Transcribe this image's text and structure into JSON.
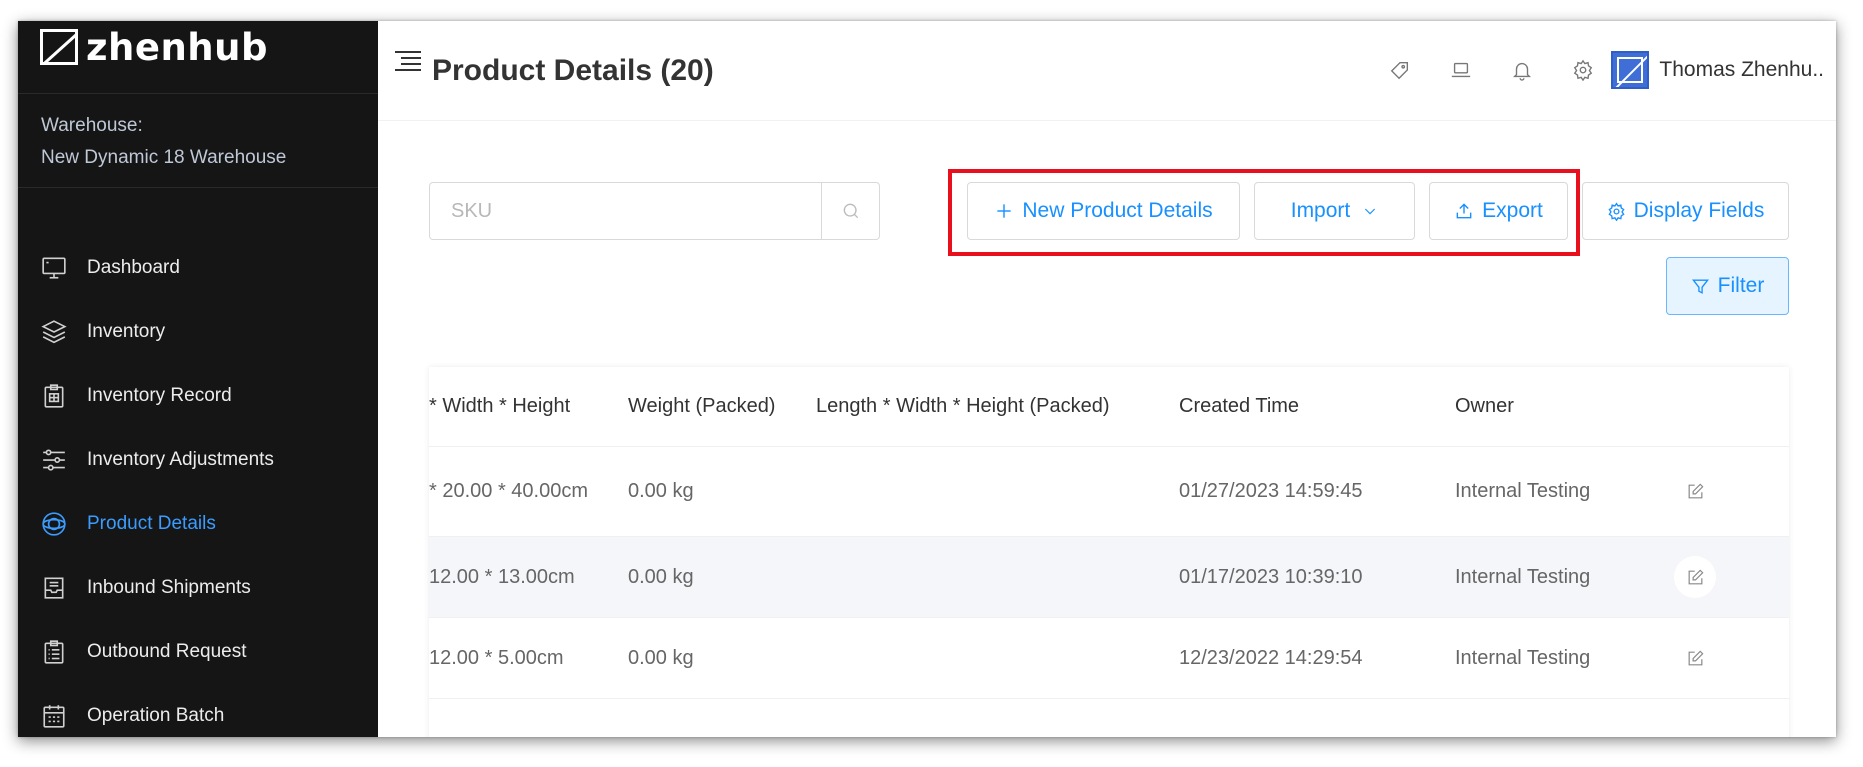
{
  "sidebar": {
    "brand": "zhenhub",
    "warehouse_label": "Warehouse:",
    "warehouse_name": "New Dynamic 18 Warehouse",
    "items": [
      {
        "label": "Dashboard",
        "icon": "monitor-icon"
      },
      {
        "label": "Inventory",
        "icon": "layers-icon"
      },
      {
        "label": "Inventory Record",
        "icon": "clipboard-icon"
      },
      {
        "label": "Inventory Adjustments",
        "icon": "sliders-icon"
      },
      {
        "label": "Product Details",
        "icon": "product-icon",
        "active": true
      },
      {
        "label": "Inbound Shipments",
        "icon": "inbox-icon"
      },
      {
        "label": "Outbound Request",
        "icon": "checklist-icon"
      },
      {
        "label": "Operation Batch",
        "icon": "calendar-icon"
      }
    ]
  },
  "header": {
    "title": "Product Details (20)",
    "user_name": "Thomas Zhenhu..",
    "icons": [
      "tag-icon",
      "laptop-icon",
      "bell-icon",
      "gear-icon"
    ]
  },
  "toolbar": {
    "search_placeholder": "SKU",
    "new_label": "New Product Details",
    "import_label": "Import",
    "export_label": "Export",
    "display_fields_label": "Display Fields",
    "filter_label": "Filter",
    "highlight_color": "#e8101c",
    "accent_color": "#1890ff"
  },
  "table": {
    "headers": [
      "* Width * Height",
      "Weight (Packed)",
      "Length * Width * Height (Packed)",
      "Created Time",
      "Owner"
    ],
    "rows": [
      [
        "* 20.00 * 40.00cm",
        "0.00 kg",
        "",
        "01/27/2023 14:59:45",
        "Internal Testing"
      ],
      [
        "12.00 * 13.00cm",
        "0.00 kg",
        "",
        "01/17/2023 10:39:10",
        "Internal Testing"
      ],
      [
        "12.00 * 5.00cm",
        "0.00 kg",
        "",
        "12/23/2022 14:29:54",
        "Internal Testing"
      ]
    ]
  }
}
